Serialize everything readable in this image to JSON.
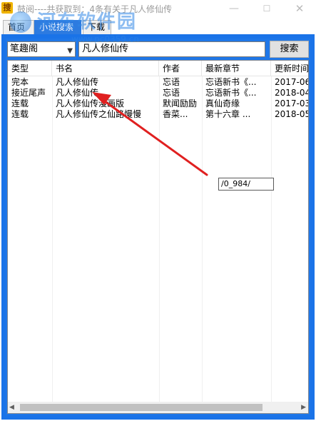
{
  "window": {
    "app_icon_text": "搜",
    "title": "鼓阅----共获取到：4条有关于凡人修仙传",
    "min_glyph": "—",
    "max_glyph": "☐",
    "close_glyph": "✕"
  },
  "watermark": {
    "text": "河东软件园",
    "url": "www.pc0359.cn"
  },
  "tabs": [
    {
      "label": "首页"
    },
    {
      "label": "小说搜索"
    },
    {
      "label": "下载"
    }
  ],
  "search": {
    "source_value": "笔趣阁",
    "query_value": "凡人修仙传",
    "button_label": "搜索"
  },
  "table": {
    "columns": [
      "类型",
      "书名",
      "作者",
      "最新章节",
      "更新时间"
    ],
    "rows": [
      [
        "完本",
        "凡人修仙传",
        "忘语",
        "忘语新书《...",
        "2017-06-"
      ],
      [
        "接近尾声",
        "凡人修仙传",
        "忘语",
        "忘语新书《...",
        "2018-04-"
      ],
      [
        "连载",
        "凡人修仙传漫画版",
        "默闻励励",
        "真仙奇缘",
        "2017-03-"
      ],
      [
        "连载",
        "凡人修仙传之仙路慢慢",
        "香菜...",
        "第十六章 ...",
        "2018-05-"
      ]
    ]
  },
  "floating_box": {
    "value": "/0_984/"
  },
  "colors": {
    "panel": "#1a73e8",
    "selected_tab": "#2d7be0",
    "annotation_arrow": "#e02020"
  }
}
